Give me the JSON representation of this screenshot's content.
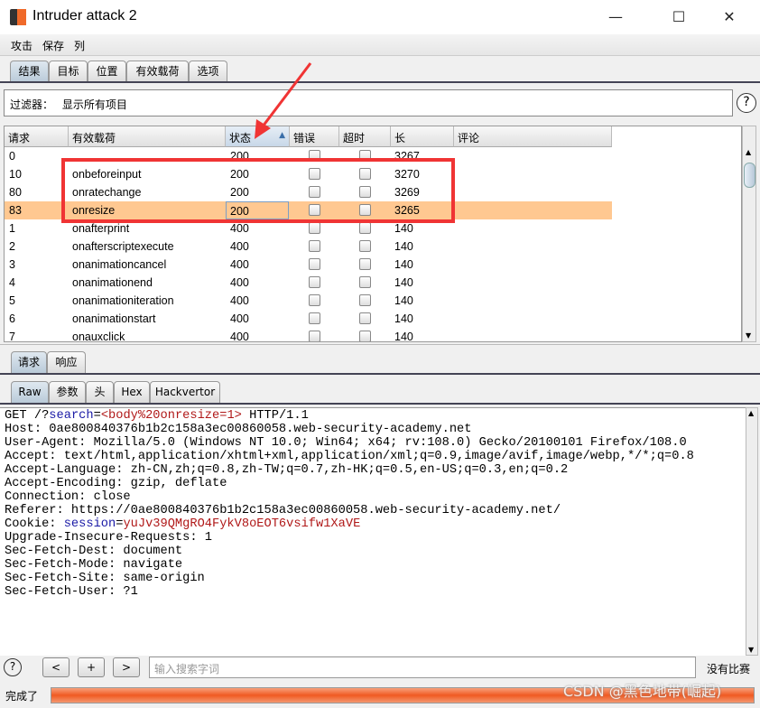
{
  "window": {
    "title": "Intruder attack 2",
    "minimize": "—",
    "maximize": "☐",
    "close": "✕"
  },
  "menu": [
    "攻击",
    "保存",
    "列"
  ],
  "tabs": [
    "结果",
    "目标",
    "位置",
    "有效载荷",
    "选项"
  ],
  "filter": {
    "label": "过滤器：",
    "value": "显示所有项目"
  },
  "help": "?",
  "table": {
    "columns": [
      "请求",
      "有效载荷",
      "状态",
      "错误",
      "超时",
      "长",
      "评论"
    ],
    "sorted_column": "状态",
    "sort_indicator": "▲",
    "rows": [
      {
        "req": "0",
        "payload": "",
        "status": "200",
        "len": "3267",
        "selected": false
      },
      {
        "req": "10",
        "payload": "onbeforeinput",
        "status": "200",
        "len": "3270",
        "selected": false
      },
      {
        "req": "80",
        "payload": "onratechange",
        "status": "200",
        "len": "3269",
        "selected": false
      },
      {
        "req": "83",
        "payload": "onresize",
        "status": "200",
        "len": "3265",
        "selected": true
      },
      {
        "req": "1",
        "payload": "onafterprint",
        "status": "400",
        "len": "140",
        "selected": false
      },
      {
        "req": "2",
        "payload": "onafterscriptexecute",
        "status": "400",
        "len": "140",
        "selected": false
      },
      {
        "req": "3",
        "payload": "onanimationcancel",
        "status": "400",
        "len": "140",
        "selected": false
      },
      {
        "req": "4",
        "payload": "onanimationend",
        "status": "400",
        "len": "140",
        "selected": false
      },
      {
        "req": "5",
        "payload": "onanimationiteration",
        "status": "400",
        "len": "140",
        "selected": false
      },
      {
        "req": "6",
        "payload": "onanimationstart",
        "status": "400",
        "len": "140",
        "selected": false
      },
      {
        "req": "7",
        "payload": "onauxclick",
        "status": "400",
        "len": "140",
        "selected": false
      }
    ]
  },
  "detail_tabs": [
    "请求",
    "响应"
  ],
  "view_tabs": [
    "Raw",
    "参数",
    "头",
    "Hex",
    "Hackvertor"
  ],
  "request": {
    "line1": {
      "prefix": "GET /?",
      "param": "search",
      "eq": "=",
      "value": "<body%20onresize=1>",
      "suffix": " HTTP/1.1"
    },
    "lines_a": [
      "Host: 0ae800840376b1b2c158a3ec00860058.web-security-academy.net",
      "User-Agent: Mozilla/5.0 (Windows NT 10.0; Win64; x64; rv:108.0) Gecko/20100101 Firefox/108.0",
      "Accept: text/html,application/xhtml+xml,application/xml;q=0.9,image/avif,image/webp,*/*;q=0.8",
      "Accept-Language: zh-CN,zh;q=0.8,zh-TW;q=0.7,zh-HK;q=0.5,en-US;q=0.3,en;q=0.2",
      "Accept-Encoding: gzip, deflate",
      "Connection: close",
      "Referer: https://0ae800840376b1b2c158a3ec00860058.web-security-academy.net/"
    ],
    "cookie": {
      "prefix": "Cookie: ",
      "name": "session",
      "eq": "=",
      "value": "yuJv39QMgRO4FykV8oEOT6vsifw1XaVE"
    },
    "lines_b": [
      "Upgrade-Insecure-Requests: 1",
      "Sec-Fetch-Dest: document",
      "Sec-Fetch-Mode: navigate",
      "Sec-Fetch-Site: same-origin",
      "Sec-Fetch-User: ?1"
    ]
  },
  "bottom": {
    "prev": "<",
    "add": "+",
    "next": ">",
    "search_placeholder": "输入搜索字词",
    "matches": "没有比赛"
  },
  "status": {
    "text": "完成了",
    "progress_percent": 100
  },
  "watermark": "CSDN @黑色地带(崛起)",
  "colors": {
    "selected_row": "#ffc891",
    "highlight_box": "#f03434",
    "progress": "#f05a22"
  }
}
